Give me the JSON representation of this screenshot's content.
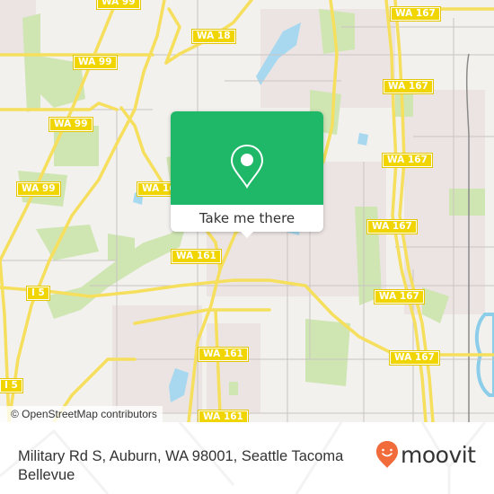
{
  "map": {
    "road_labels": [
      {
        "id": "wa99-top",
        "text": "WA 99"
      },
      {
        "id": "wa18",
        "text": "WA 18"
      },
      {
        "id": "wa99-a",
        "text": "WA 99"
      },
      {
        "id": "wa99-b",
        "text": "WA 99"
      },
      {
        "id": "wa99-c",
        "text": "WA 99"
      },
      {
        "id": "wa161-a",
        "text": "WA 161"
      },
      {
        "id": "wa161-b",
        "text": "WA 161"
      },
      {
        "id": "wa161-c",
        "text": "WA 161"
      },
      {
        "id": "wa161-d",
        "text": "WA 161"
      },
      {
        "id": "i5-a",
        "text": "I 5"
      },
      {
        "id": "i5-b",
        "text": "I 5"
      },
      {
        "id": "wa167-a",
        "text": "WA 167"
      },
      {
        "id": "wa167-b",
        "text": "WA 167"
      },
      {
        "id": "wa167-c",
        "text": "WA 167"
      },
      {
        "id": "wa167-d",
        "text": "WA 167"
      },
      {
        "id": "wa167-e",
        "text": "WA 167"
      },
      {
        "id": "wa167-f",
        "text": "WA 167"
      }
    ],
    "attribution": "© OpenStreetMap contributors",
    "colors": {
      "road": "#f5df5c",
      "park": "#cfe5b2",
      "water": "#a8d8ef",
      "urban": "#ebe4e2",
      "base": "#f2f1ee",
      "shield": "#f1d500"
    }
  },
  "popup": {
    "icon": "map-pin-icon",
    "button_label": "Take me there",
    "accent": "#1fb768"
  },
  "footer": {
    "address": "Military Rd S, Auburn, WA 98001, Seattle Tacoma Bellevue",
    "brand": "moovit",
    "brand_color": "#f26b3a"
  }
}
